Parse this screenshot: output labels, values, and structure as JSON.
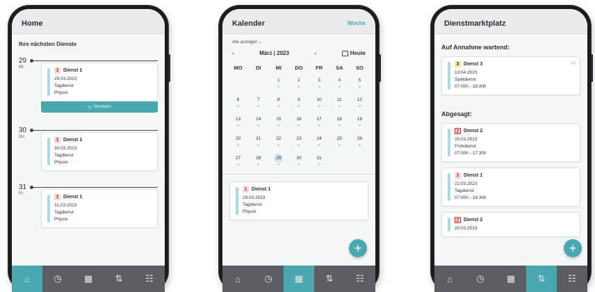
{
  "screens": {
    "home": {
      "title": "Home",
      "section": "Ihre nächsten Dienste",
      "days": [
        {
          "num": "29",
          "weekday": "Mi.",
          "badge": "1",
          "dienst": "Dienst 1",
          "date": "29.03.2023",
          "type": "Tagdienst",
          "dept": "Physio",
          "action": "Stempeln"
        },
        {
          "num": "30",
          "weekday": "Do.",
          "badge": "1",
          "dienst": "Dienst 1",
          "date": "30.03.2023",
          "type": "Tagdienst",
          "dept": "Physio"
        },
        {
          "num": "31",
          "weekday": "Fr.",
          "badge": "1",
          "dienst": "Dienst 1",
          "date": "31.03.2023",
          "type": "Tagdienst",
          "dept": "Physio"
        }
      ]
    },
    "kalender": {
      "title": "Kalender",
      "view_link": "Woche",
      "filter": "Alle anzeigen ⌄",
      "prev": "‹",
      "next": "›",
      "month": "März | 2023",
      "today": "Heute",
      "weekdays": [
        "MO",
        "DI",
        "MI",
        "DO",
        "FR",
        "SA",
        "SO"
      ],
      "weeks": [
        [
          "",
          "",
          "1",
          "2",
          "3",
          "4",
          "5"
        ],
        [
          "6",
          "7",
          "8",
          "9",
          "10",
          "11",
          "12"
        ],
        [
          "13",
          "14",
          "15",
          "16",
          "17",
          "18",
          "19"
        ],
        [
          "20",
          "21",
          "22",
          "23",
          "24",
          "25",
          "26"
        ],
        [
          "27",
          "28",
          "29",
          "30",
          "31",
          "",
          ""
        ]
      ],
      "selected": "29",
      "card": {
        "badge": "1",
        "dienst": "Dienst 1",
        "date": "29.03.2023",
        "type": "Tagdienst",
        "dept": "Physio"
      },
      "fab": "+"
    },
    "marktplatz": {
      "title": "Dienstmarktplatz",
      "waiting_title": "Auf Annahme wartend:",
      "waiting": [
        {
          "badge": "3",
          "dienst": "Dienst 3",
          "date": "13.04.2023",
          "type": "Spätdienst",
          "time": "07:00h - 18:00h"
        }
      ],
      "declined_title": "Abgesagt:",
      "declined": [
        {
          "badge": "2",
          "dienst": "Dienst 2",
          "date": "20.03.2023",
          "type": "Frühdienst",
          "time": "07:00h - 17:30h"
        },
        {
          "badge": "1",
          "dienst": "Dienst 1",
          "date": "22.03.2023",
          "type": "Tagdienst",
          "time": "07:00h - 18:30h"
        },
        {
          "badge": "2",
          "dienst": "Dienst 2",
          "date": "20.03.2023"
        }
      ],
      "fab": "+"
    }
  },
  "nav": {
    "items": [
      {
        "icon": "home-icon",
        "glyph": "⌂"
      },
      {
        "icon": "clock-icon",
        "glyph": "◷"
      },
      {
        "icon": "calendar-icon",
        "glyph": "▦"
      },
      {
        "icon": "swap-icon",
        "glyph": "⇅"
      },
      {
        "icon": "people-icon",
        "glyph": "☷"
      }
    ]
  },
  "colors": {
    "accent": "#4aa8b0",
    "nav_bg": "#5a5e63",
    "badge_red": "#f8d7d7"
  }
}
